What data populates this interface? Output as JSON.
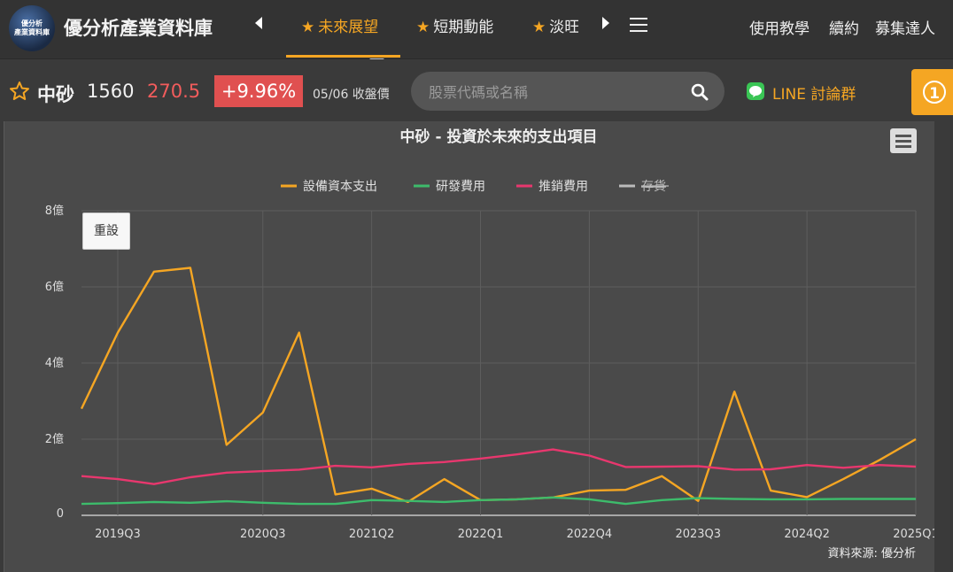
{
  "site": {
    "title": "優分析產業資料庫",
    "logo_line1": "優分析",
    "logo_line2": "產業資料庫"
  },
  "nav": {
    "tabs": [
      {
        "label": "未來展望",
        "active": true
      },
      {
        "label": "短期動能",
        "active": false
      },
      {
        "label": "淡旺",
        "active": false
      }
    ],
    "right_links": [
      "使用教學",
      "續約",
      "募集達人"
    ]
  },
  "stock": {
    "name": "中砂",
    "code": "1560",
    "price": "270.5",
    "change": "+9.96%",
    "date_label": "05/06 收盤價"
  },
  "search": {
    "placeholder": "股票代碼或名稱"
  },
  "line": {
    "label": "LINE 討論群"
  },
  "notification": {
    "count": "1"
  },
  "reset_label": "重設",
  "colors": {
    "accent": "#f5a623",
    "up": "#e05050",
    "capex": "#f5a623",
    "rd": "#3dbb6b",
    "sales": "#e8376e",
    "inventory": "#bbbbbb"
  },
  "chart_data": {
    "type": "line",
    "title": "中砂 - 投資於未來的支出項目",
    "source": "資料來源: 優分析",
    "yticks": [
      "0",
      "2億",
      "4億",
      "6億",
      "8億"
    ],
    "ylim": [
      0,
      8
    ],
    "xticks": [
      "2019Q3",
      "2020Q3",
      "2021Q2",
      "2022Q1",
      "2022Q4",
      "2023Q3",
      "2024Q2",
      "2025Q1"
    ],
    "x": [
      "2019Q2",
      "2019Q3",
      "2019Q4",
      "2020Q1",
      "2020Q2",
      "2020Q3",
      "2020Q4",
      "2021Q1",
      "2021Q2",
      "2021Q3",
      "2021Q4",
      "2022Q1",
      "2022Q2",
      "2022Q3",
      "2022Q4",
      "2023Q1",
      "2023Q2",
      "2023Q3",
      "2023Q4",
      "2024Q1",
      "2024Q2",
      "2024Q3",
      "2024Q4",
      "2025Q1"
    ],
    "series": [
      {
        "name": "設備資本支出",
        "color": "#f5a623",
        "values": [
          2.8,
          4.8,
          6.4,
          6.5,
          1.85,
          2.7,
          4.8,
          0.55,
          0.7,
          0.35,
          0.95,
          0.4,
          0.42,
          0.47,
          0.65,
          0.67,
          1.03,
          0.38,
          3.25,
          0.65,
          0.48,
          0.95,
          1.45,
          2.0
        ],
        "hidden": false
      },
      {
        "name": "研發費用",
        "color": "#3dbb6b",
        "values": [
          0.3,
          0.32,
          0.35,
          0.33,
          0.37,
          0.33,
          0.3,
          0.3,
          0.4,
          0.38,
          0.35,
          0.4,
          0.42,
          0.47,
          0.42,
          0.3,
          0.4,
          0.45,
          0.43,
          0.42,
          0.42,
          0.43,
          0.43,
          0.43
        ],
        "hidden": false
      },
      {
        "name": "推銷費用",
        "color": "#e8376e",
        "values": [
          1.03,
          0.95,
          0.82,
          1.0,
          1.12,
          1.16,
          1.2,
          1.3,
          1.26,
          1.35,
          1.4,
          1.49,
          1.6,
          1.73,
          1.57,
          1.27,
          1.28,
          1.29,
          1.2,
          1.21,
          1.32,
          1.25,
          1.32,
          1.28
        ],
        "hidden": false
      },
      {
        "name": "存貨",
        "color": "#bbbbbb",
        "values": [],
        "hidden": true
      }
    ]
  }
}
